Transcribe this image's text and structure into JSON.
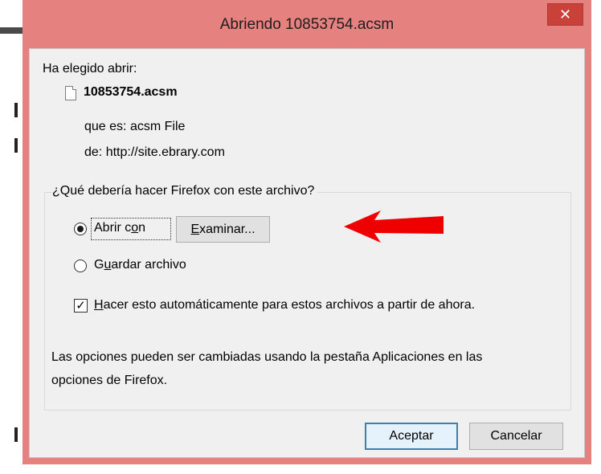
{
  "window": {
    "title": "Abriendo 10853754.acsm",
    "close_glyph": "✕"
  },
  "dialog": {
    "intro": "Ha elegido abrir:",
    "file_name": "10853754.acsm",
    "type_label": "que es:",
    "type_value": "acsm File",
    "from_label": "de:",
    "from_value": "http://site.ebrary.com",
    "question": "¿Qué debería hacer Firefox con este archivo?",
    "open_with": {
      "pre": "Abrir c",
      "accel": "o",
      "post": "n",
      "checked": true
    },
    "browse_button": {
      "accel": "E",
      "post": "xaminar..."
    },
    "save_file": {
      "pre": "G",
      "accel": "u",
      "post": "ardar archivo",
      "checked": false
    },
    "auto_action": {
      "accel": "H",
      "post": "acer esto automáticamente para estos archivos a partir de ahora.",
      "checked": true
    },
    "note_line1": "Las opciones pueden ser cambiadas usando la pestaña Aplicaciones en las",
    "note_line2": "opciones de Firefox.",
    "ok_label": "Aceptar",
    "cancel_label": "Cancelar"
  },
  "icons": {
    "file": "file-icon",
    "close": "close-icon",
    "annotation_arrow": "red-arrow-icon"
  },
  "colors": {
    "title_bar": "#e5817f",
    "close_button": "#c9423a",
    "arrow": "#ee0000",
    "default_button_border": "#3c7fb1"
  }
}
